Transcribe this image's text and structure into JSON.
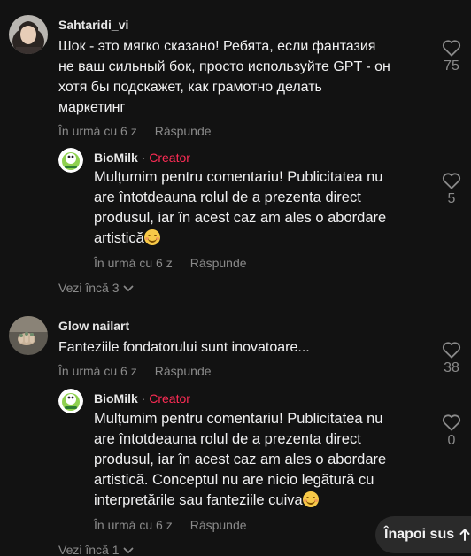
{
  "comments": [
    {
      "username": "Sahtaridi_vi",
      "text_lines": [
        "Шок - это мягко сказано! Ребята, если фантазия",
        "не ваш сильный бок, просто используйте GPT - он",
        "хотя бы подскажет, как грамотно делать",
        "маркетинг"
      ],
      "time": "În urmă cu 6 z",
      "reply_label": "Răspunde",
      "likes": "75",
      "reply": {
        "username": "BioMilk",
        "dot": "·",
        "badge": "Creator",
        "text_lines": [
          "Mulțumim pentru comentariu! Publicitatea nu",
          "are întotdeauna rolul de a prezenta direct",
          "produsul, iar în acest caz am ales o abordare",
          "artistică"
        ],
        "emoji": "smiling-face-emoji",
        "time": "În urmă cu 6 z",
        "reply_label": "Răspunde",
        "likes": "5"
      },
      "view_more": "Vezi încă 3"
    },
    {
      "username": "Glow nailart",
      "text_lines": [
        "Fanteziile fondatorului sunt inovatoare..."
      ],
      "time": "În urmă cu 6 z",
      "reply_label": "Răspunde",
      "likes": "38",
      "reply": {
        "username": "BioMilk",
        "dot": "·",
        "badge": "Creator",
        "text_lines": [
          "Mulțumim pentru comentariu! Publicitatea nu",
          "are întotdeauna rolul de a prezenta direct",
          "produsul, iar în acest caz am ales o abordare",
          "artistică. Conceptul nu are nicio legătură cu",
          "interpretările sau fanteziile cuiva"
        ],
        "emoji": "smiling-face-emoji",
        "time": "În urmă cu 6 z",
        "reply_label": "Răspunde",
        "likes": "0"
      },
      "view_more": "Vezi încă 1"
    }
  ],
  "back_to_top": "Înapoi sus",
  "colors": {
    "background": "#121212",
    "creator": "#fe2c55",
    "muted": "#8a8a8a",
    "text": "#f1f1f2"
  }
}
